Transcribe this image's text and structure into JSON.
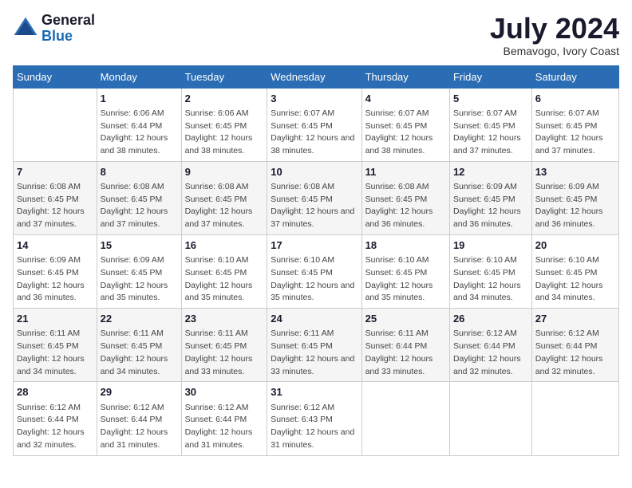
{
  "header": {
    "logo_general": "General",
    "logo_blue": "Blue",
    "month_title": "July 2024",
    "subtitle": "Bemavogo, Ivory Coast"
  },
  "days_of_week": [
    "Sunday",
    "Monday",
    "Tuesday",
    "Wednesday",
    "Thursday",
    "Friday",
    "Saturday"
  ],
  "weeks": [
    [
      {
        "day": "",
        "sunrise": "",
        "sunset": "",
        "daylight": ""
      },
      {
        "day": "1",
        "sunrise": "Sunrise: 6:06 AM",
        "sunset": "Sunset: 6:44 PM",
        "daylight": "Daylight: 12 hours and 38 minutes."
      },
      {
        "day": "2",
        "sunrise": "Sunrise: 6:06 AM",
        "sunset": "Sunset: 6:45 PM",
        "daylight": "Daylight: 12 hours and 38 minutes."
      },
      {
        "day": "3",
        "sunrise": "Sunrise: 6:07 AM",
        "sunset": "Sunset: 6:45 PM",
        "daylight": "Daylight: 12 hours and 38 minutes."
      },
      {
        "day": "4",
        "sunrise": "Sunrise: 6:07 AM",
        "sunset": "Sunset: 6:45 PM",
        "daylight": "Daylight: 12 hours and 38 minutes."
      },
      {
        "day": "5",
        "sunrise": "Sunrise: 6:07 AM",
        "sunset": "Sunset: 6:45 PM",
        "daylight": "Daylight: 12 hours and 37 minutes."
      },
      {
        "day": "6",
        "sunrise": "Sunrise: 6:07 AM",
        "sunset": "Sunset: 6:45 PM",
        "daylight": "Daylight: 12 hours and 37 minutes."
      }
    ],
    [
      {
        "day": "7",
        "sunrise": "Sunrise: 6:08 AM",
        "sunset": "Sunset: 6:45 PM",
        "daylight": "Daylight: 12 hours and 37 minutes."
      },
      {
        "day": "8",
        "sunrise": "Sunrise: 6:08 AM",
        "sunset": "Sunset: 6:45 PM",
        "daylight": "Daylight: 12 hours and 37 minutes."
      },
      {
        "day": "9",
        "sunrise": "Sunrise: 6:08 AM",
        "sunset": "Sunset: 6:45 PM",
        "daylight": "Daylight: 12 hours and 37 minutes."
      },
      {
        "day": "10",
        "sunrise": "Sunrise: 6:08 AM",
        "sunset": "Sunset: 6:45 PM",
        "daylight": "Daylight: 12 hours and 37 minutes."
      },
      {
        "day": "11",
        "sunrise": "Sunrise: 6:08 AM",
        "sunset": "Sunset: 6:45 PM",
        "daylight": "Daylight: 12 hours and 36 minutes."
      },
      {
        "day": "12",
        "sunrise": "Sunrise: 6:09 AM",
        "sunset": "Sunset: 6:45 PM",
        "daylight": "Daylight: 12 hours and 36 minutes."
      },
      {
        "day": "13",
        "sunrise": "Sunrise: 6:09 AM",
        "sunset": "Sunset: 6:45 PM",
        "daylight": "Daylight: 12 hours and 36 minutes."
      }
    ],
    [
      {
        "day": "14",
        "sunrise": "Sunrise: 6:09 AM",
        "sunset": "Sunset: 6:45 PM",
        "daylight": "Daylight: 12 hours and 36 minutes."
      },
      {
        "day": "15",
        "sunrise": "Sunrise: 6:09 AM",
        "sunset": "Sunset: 6:45 PM",
        "daylight": "Daylight: 12 hours and 35 minutes."
      },
      {
        "day": "16",
        "sunrise": "Sunrise: 6:10 AM",
        "sunset": "Sunset: 6:45 PM",
        "daylight": "Daylight: 12 hours and 35 minutes."
      },
      {
        "day": "17",
        "sunrise": "Sunrise: 6:10 AM",
        "sunset": "Sunset: 6:45 PM",
        "daylight": "Daylight: 12 hours and 35 minutes."
      },
      {
        "day": "18",
        "sunrise": "Sunrise: 6:10 AM",
        "sunset": "Sunset: 6:45 PM",
        "daylight": "Daylight: 12 hours and 35 minutes."
      },
      {
        "day": "19",
        "sunrise": "Sunrise: 6:10 AM",
        "sunset": "Sunset: 6:45 PM",
        "daylight": "Daylight: 12 hours and 34 minutes."
      },
      {
        "day": "20",
        "sunrise": "Sunrise: 6:10 AM",
        "sunset": "Sunset: 6:45 PM",
        "daylight": "Daylight: 12 hours and 34 minutes."
      }
    ],
    [
      {
        "day": "21",
        "sunrise": "Sunrise: 6:11 AM",
        "sunset": "Sunset: 6:45 PM",
        "daylight": "Daylight: 12 hours and 34 minutes."
      },
      {
        "day": "22",
        "sunrise": "Sunrise: 6:11 AM",
        "sunset": "Sunset: 6:45 PM",
        "daylight": "Daylight: 12 hours and 34 minutes."
      },
      {
        "day": "23",
        "sunrise": "Sunrise: 6:11 AM",
        "sunset": "Sunset: 6:45 PM",
        "daylight": "Daylight: 12 hours and 33 minutes."
      },
      {
        "day": "24",
        "sunrise": "Sunrise: 6:11 AM",
        "sunset": "Sunset: 6:45 PM",
        "daylight": "Daylight: 12 hours and 33 minutes."
      },
      {
        "day": "25",
        "sunrise": "Sunrise: 6:11 AM",
        "sunset": "Sunset: 6:44 PM",
        "daylight": "Daylight: 12 hours and 33 minutes."
      },
      {
        "day": "26",
        "sunrise": "Sunrise: 6:12 AM",
        "sunset": "Sunset: 6:44 PM",
        "daylight": "Daylight: 12 hours and 32 minutes."
      },
      {
        "day": "27",
        "sunrise": "Sunrise: 6:12 AM",
        "sunset": "Sunset: 6:44 PM",
        "daylight": "Daylight: 12 hours and 32 minutes."
      }
    ],
    [
      {
        "day": "28",
        "sunrise": "Sunrise: 6:12 AM",
        "sunset": "Sunset: 6:44 PM",
        "daylight": "Daylight: 12 hours and 32 minutes."
      },
      {
        "day": "29",
        "sunrise": "Sunrise: 6:12 AM",
        "sunset": "Sunset: 6:44 PM",
        "daylight": "Daylight: 12 hours and 31 minutes."
      },
      {
        "day": "30",
        "sunrise": "Sunrise: 6:12 AM",
        "sunset": "Sunset: 6:44 PM",
        "daylight": "Daylight: 12 hours and 31 minutes."
      },
      {
        "day": "31",
        "sunrise": "Sunrise: 6:12 AM",
        "sunset": "Sunset: 6:43 PM",
        "daylight": "Daylight: 12 hours and 31 minutes."
      },
      {
        "day": "",
        "sunrise": "",
        "sunset": "",
        "daylight": ""
      },
      {
        "day": "",
        "sunrise": "",
        "sunset": "",
        "daylight": ""
      },
      {
        "day": "",
        "sunrise": "",
        "sunset": "",
        "daylight": ""
      }
    ]
  ]
}
